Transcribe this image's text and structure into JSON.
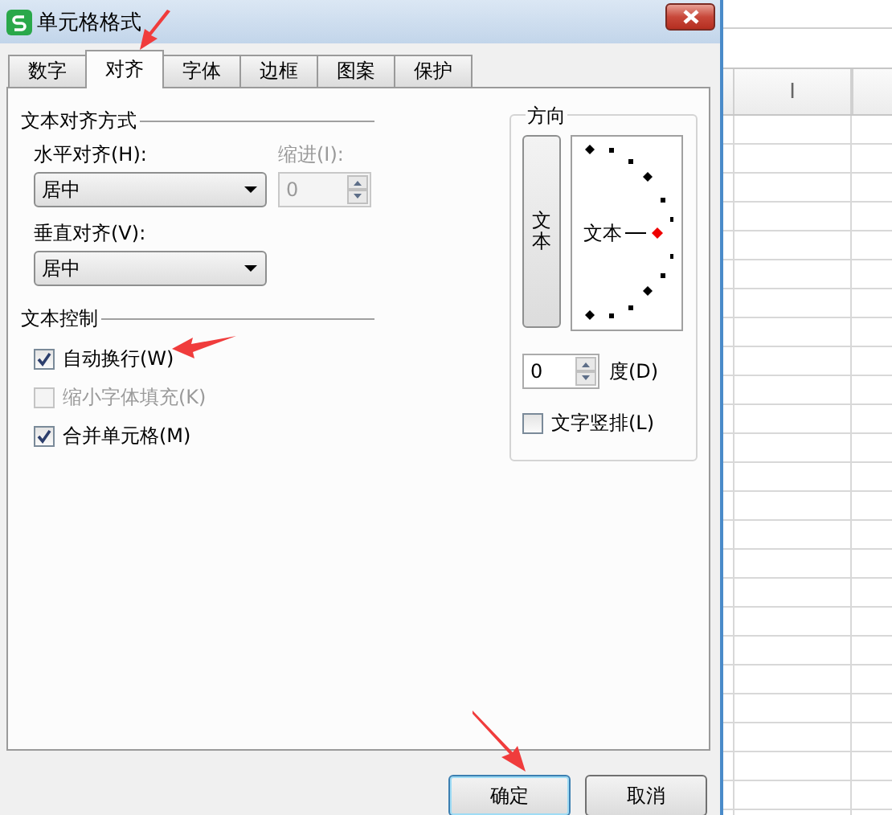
{
  "window": {
    "title": "单元格格式"
  },
  "tabs": [
    {
      "label": "数字",
      "selected": false
    },
    {
      "label": "对齐",
      "selected": true
    },
    {
      "label": "字体",
      "selected": false
    },
    {
      "label": "边框",
      "selected": false
    },
    {
      "label": "图案",
      "selected": false
    },
    {
      "label": "保护",
      "selected": false
    }
  ],
  "text_alignment": {
    "heading": "文本对齐方式",
    "horizontal": {
      "label": "水平对齐(H):",
      "value": "居中"
    },
    "indent": {
      "label": "缩进(I):",
      "value": "0",
      "disabled": true
    },
    "vertical": {
      "label": "垂直对齐(V):",
      "value": "居中"
    }
  },
  "text_control": {
    "heading": "文本控制",
    "options": [
      {
        "label": "自动换行(W)",
        "checked": true,
        "disabled": false
      },
      {
        "label": "缩小字体填充(K)",
        "checked": false,
        "disabled": true
      },
      {
        "label": "合并单元格(M)",
        "checked": true,
        "disabled": false
      }
    ]
  },
  "orientation": {
    "heading": "方向",
    "vertical_text_button": "文本",
    "dial_label": "文本",
    "degrees": {
      "value": "0",
      "label": "度(D)"
    },
    "vertical_text": {
      "label": "文字竖排(L)",
      "checked": false
    }
  },
  "buttons": [
    {
      "label": "确定",
      "default": true
    },
    {
      "label": "取消",
      "default": false
    }
  ],
  "spreadsheet": {
    "column_header": "I"
  }
}
